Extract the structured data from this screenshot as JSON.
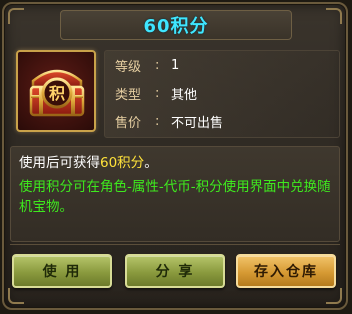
{
  "title": "60积分",
  "item_icon": {
    "name": "points-chest-icon",
    "glyph": "积"
  },
  "info": {
    "level_label": "等级",
    "level_value": "1",
    "type_label": "类型",
    "type_value": "其他",
    "price_label": "售价",
    "price_value": "不可出售",
    "separator": ":"
  },
  "description": {
    "line1_prefix": "使用后可获得",
    "line1_highlight": "60积分",
    "line1_suffix": "。",
    "line2": "使用积分可在角色-属性-代币-积分使用界面中兑换随机宝物。"
  },
  "buttons": {
    "use": "使 用",
    "share": "分 享",
    "store": "存入仓库"
  },
  "colors": {
    "title": "#3fe6ff",
    "highlight": "#ffe23a",
    "hint": "#3eea1e",
    "label": "#e4cda0"
  }
}
